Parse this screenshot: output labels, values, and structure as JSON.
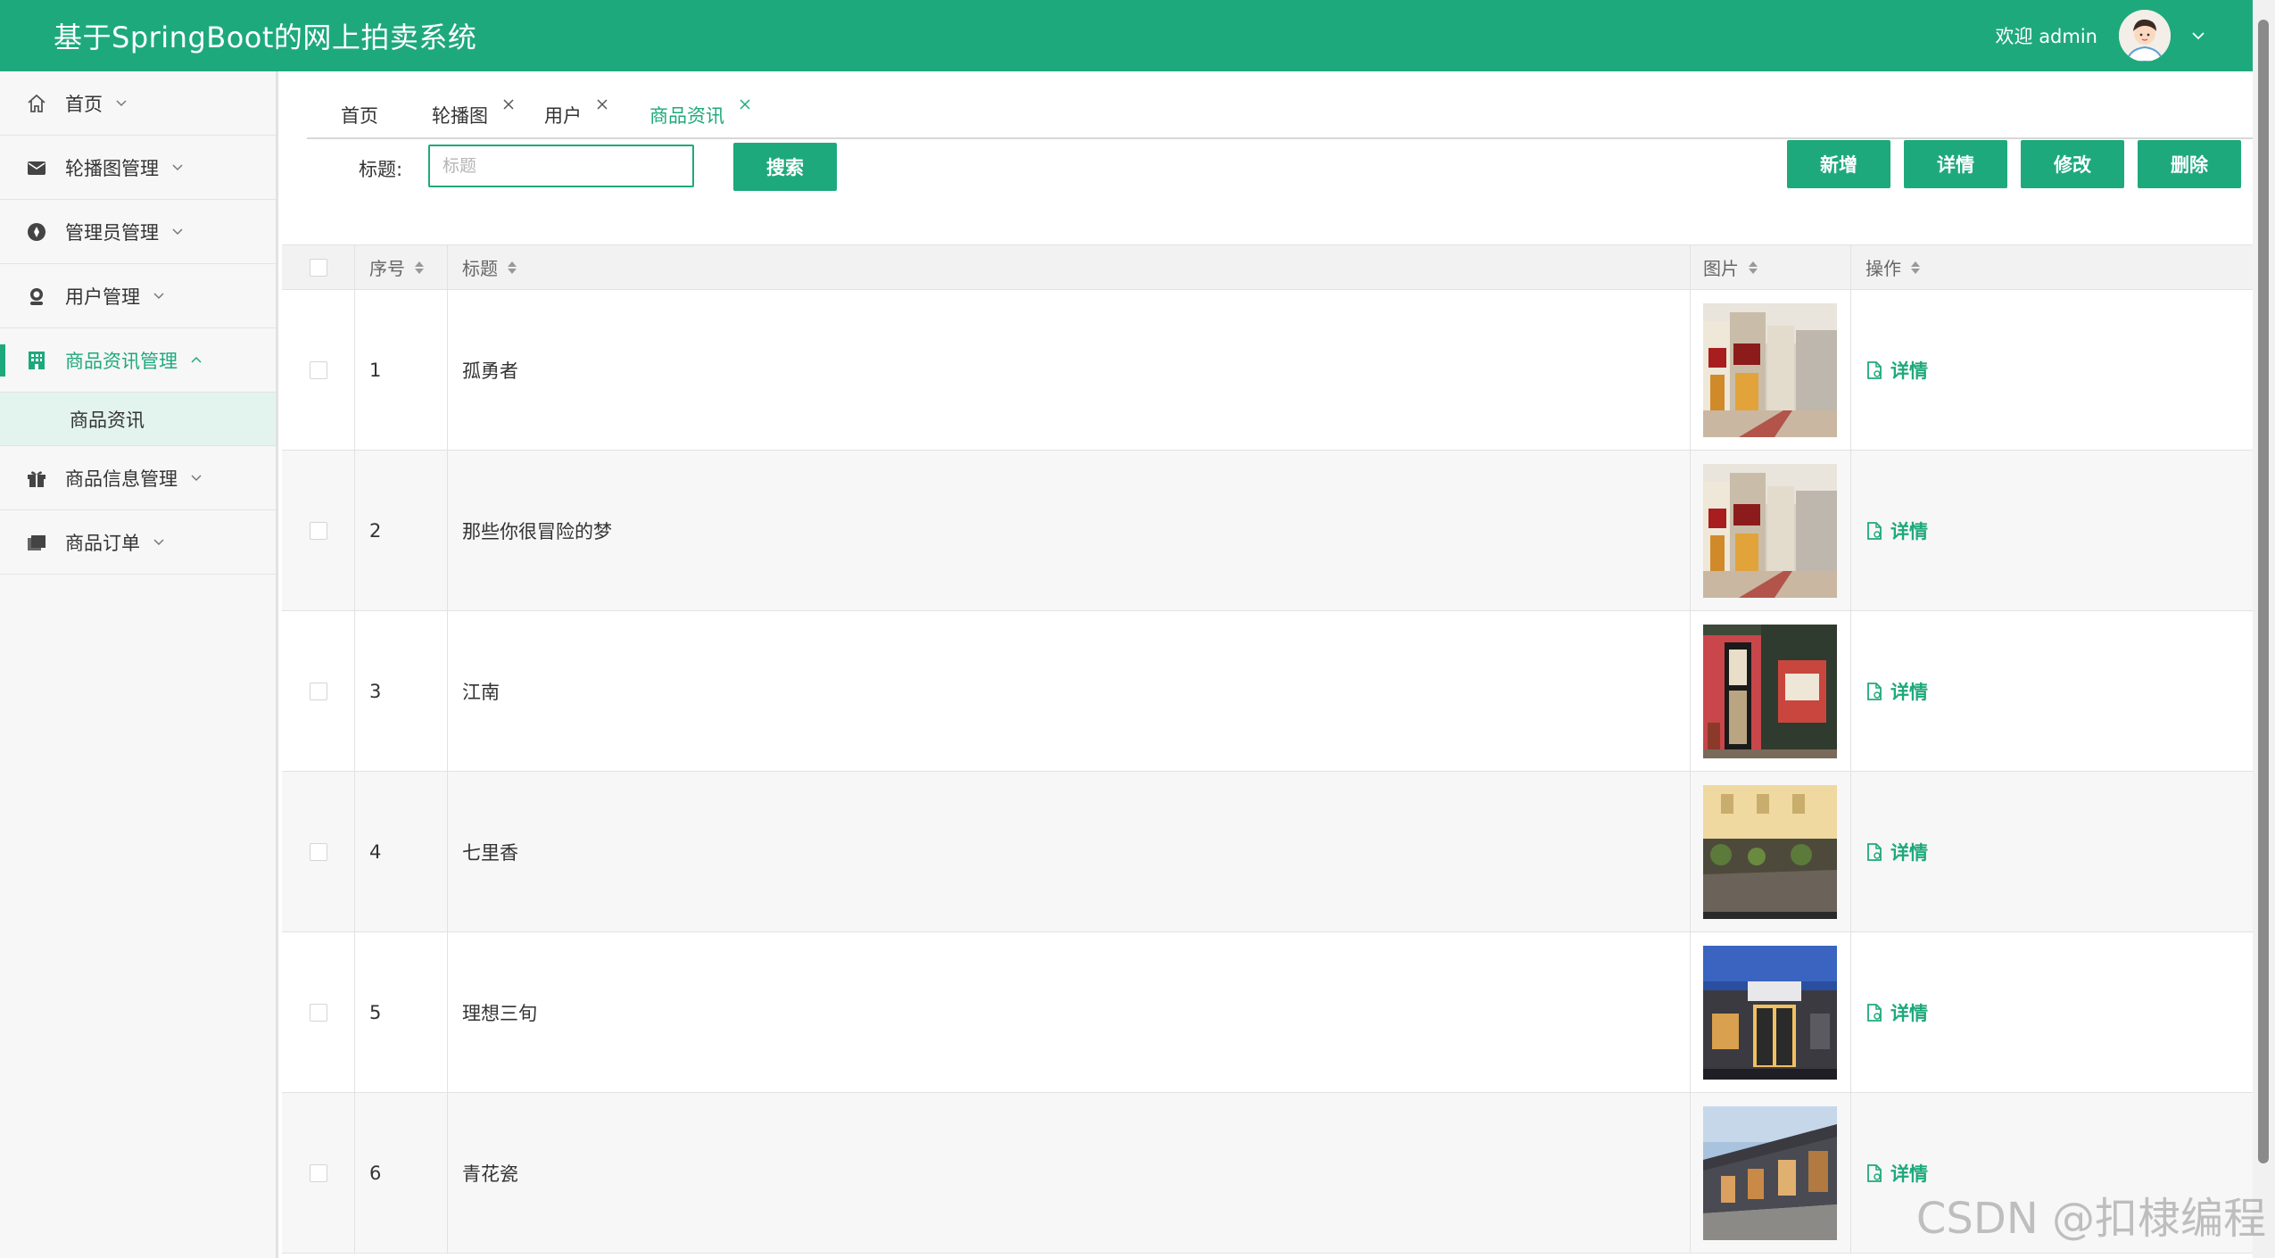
{
  "header": {
    "title": "基于SpringBoot的网上拍卖系统",
    "welcome": "欢迎 admin",
    "brand_color": "#1ea97c"
  },
  "sidebar": {
    "items": [
      {
        "label": "首页",
        "icon": "home-icon"
      },
      {
        "label": "轮播图管理",
        "icon": "envelope-icon"
      },
      {
        "label": "管理员管理",
        "icon": "compass-icon"
      },
      {
        "label": "用户管理",
        "icon": "user-icon"
      },
      {
        "label": "商品资讯管理",
        "icon": "building-icon",
        "expanded": true
      },
      {
        "label": "商品信息管理",
        "icon": "gift-icon"
      },
      {
        "label": "商品订单",
        "icon": "folders-icon"
      }
    ],
    "submenu": {
      "label": "商品资讯"
    }
  },
  "tabs": [
    {
      "label": "首页"
    },
    {
      "label": "轮播图"
    },
    {
      "label": "用户"
    },
    {
      "label": "商品资讯",
      "active": true
    }
  ],
  "search": {
    "label": "标题:",
    "placeholder": "标题",
    "value": "",
    "button": "搜索"
  },
  "toolbar": {
    "add": "新增",
    "detail": "详情",
    "edit": "修改",
    "delete": "删除"
  },
  "table": {
    "columns": [
      "序号",
      "标题",
      "图片",
      "操作"
    ],
    "action_label": "详情",
    "rows": [
      {
        "index": "1",
        "title": "孤勇者",
        "image": "street-storefront-photo"
      },
      {
        "index": "2",
        "title": "那些你很冒险的梦",
        "image": "street-storefront-photo"
      },
      {
        "index": "3",
        "title": "江南",
        "image": "red-shopfront-photo"
      },
      {
        "index": "4",
        "title": "七里香",
        "image": "cafe-street-photo"
      },
      {
        "index": "5",
        "title": "理想三旬",
        "image": "night-storefront-photo"
      },
      {
        "index": "6",
        "title": "青花瓷",
        "image": "modern-building-photo"
      }
    ]
  },
  "watermark": "CSDN @扣棣编程"
}
